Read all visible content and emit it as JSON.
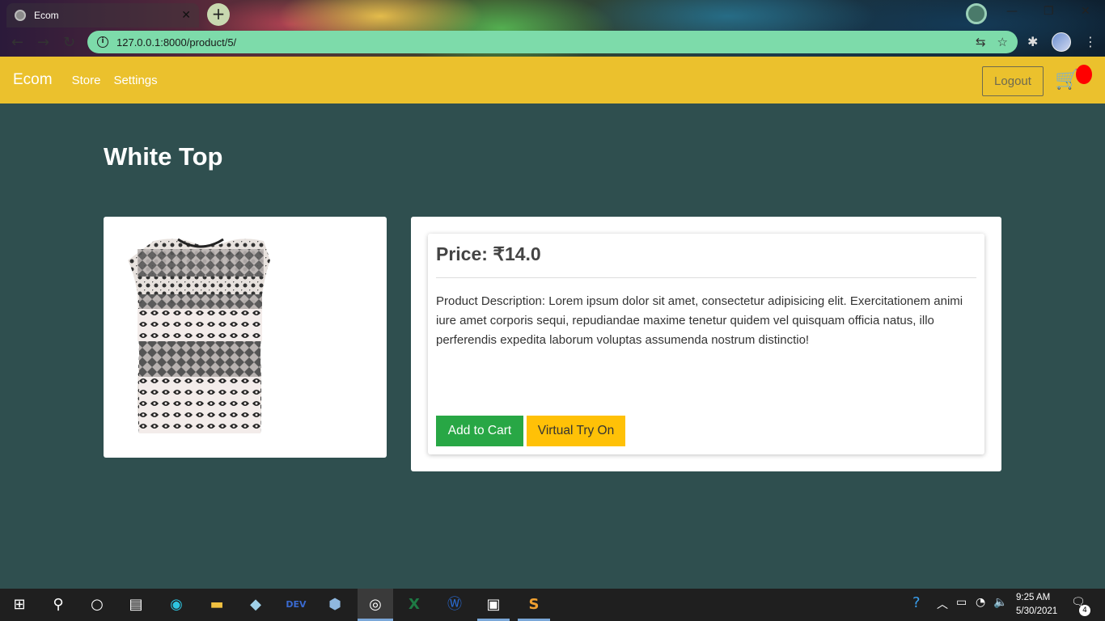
{
  "browser": {
    "tab_title": "Ecom",
    "new_tab_symbol": "+",
    "close_symbol": "✕",
    "url": "127.0.0.1:8000/product/5/",
    "icons": [
      "back-icon",
      "forward-icon",
      "reload-icon",
      "info-icon",
      "translate-icon",
      "star-icon",
      "extensions-icon",
      "profile-avatar"
    ]
  },
  "navbar": {
    "brand": "Ecom",
    "links": [
      "Store",
      "Settings"
    ],
    "logout_label": "Logout",
    "cart_icon": "cart-icon",
    "bg_color": "#ebc12d"
  },
  "product": {
    "title": "White Top",
    "price_text": "Price: ₹14.0",
    "description": "Product Description: Lorem ipsum dolor sit amet, consectetur adipisicing elit. Exercitationem animi iure amet corporis sequi, repudiandae maxime tenetur quidem vel quisquam officia natus, illo perferendis expedita laborum voluptas assumenda nostrum distinctio!",
    "add_to_cart_label": "Add to Cart",
    "try_on_label": "Virtual Try On",
    "colors": {
      "add_to_cart": "#28a745",
      "try_on": "#ffc107",
      "page_bg": "#2f4f4f"
    }
  },
  "taskbar": {
    "time": "9:25 AM",
    "date": "5/30/2021",
    "notification_count": "4",
    "icons": [
      "windows-start-icon",
      "search-icon",
      "cortana-icon",
      "task-view-icon",
      "edge-icon",
      "file-explorer-icon",
      "app-icon",
      "devc-icon",
      "3d-viewer-icon",
      "chrome-icon",
      "excel-icon",
      "app-w-icon",
      "terminal-icon",
      "sublime-icon"
    ]
  }
}
